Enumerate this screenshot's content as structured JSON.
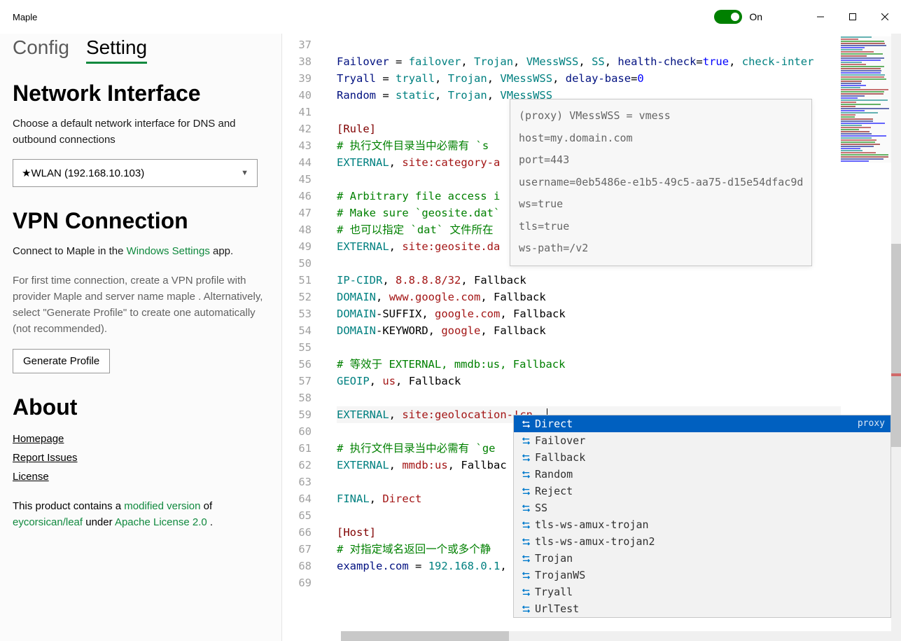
{
  "window": {
    "title": "Maple",
    "toggle_label": "On",
    "toggle_on": true
  },
  "tabs": {
    "config": "Config",
    "setting": "Setting",
    "active": "setting"
  },
  "sidebar": {
    "net_h": "Network Interface",
    "net_p": "Choose a default network interface for DNS and outbound connections",
    "net_select": "★WLAN (192.168.10.103)",
    "vpn_h": "VPN Connection",
    "vpn_p1a": "Connect to Maple in the ",
    "vpn_p1b": "Windows Settings",
    "vpn_p1c": " app.",
    "vpn_p2": "For first time connection, create a VPN profile with provider Maple and server name maple . Alternatively, select \"Generate Profile\" to create one automatically (not recommended).",
    "vpn_btn": "Generate Profile",
    "about_h": "About",
    "about_l1": "Homepage",
    "about_l2": "Report Issues",
    "about_l3": "License",
    "about_p_a": "This product contains a ",
    "about_p_b": "modified version",
    "about_p_c": " of ",
    "about_p_d": "eycorsican/leaf",
    "about_p_e": " under ",
    "about_p_f": "Apache License 2.0",
    "about_p_g": " ."
  },
  "editor": {
    "first_line_no": 37,
    "lines": [
      "",
      "Failover = failover, Trojan, VMessWSS, SS, health-check=true, check-inter",
      "Tryall = tryall, Trojan, VMessWSS, delay-base=0",
      "Random = static, Trojan, VMessWSS",
      "",
      "[Rule]",
      "# 执行文件目录当中必需有 `s",
      "EXTERNAL, site:category-a",
      "",
      "# Arbitrary file access i",
      "# Make sure `geosite.dat`",
      "# 也可以指定 `dat` 文件所在",
      "EXTERNAL, site:geosite.da",
      "",
      "IP-CIDR, 8.8.8.8/32, Fallback",
      "DOMAIN, www.google.com, Fallback",
      "DOMAIN-SUFFIX, google.com, Fallback",
      "DOMAIN-KEYWORD, google, Fallback",
      "",
      "# 等效于 EXTERNAL, mmdb:us, Fallback",
      "GEOIP, us, Fallback",
      "",
      "EXTERNAL, site:geolocation-!cn, ",
      "",
      "# 执行文件目录当中必需有 `ge",
      "EXTERNAL, mmdb:us, Fallbac",
      "",
      "FINAL, Direct",
      "",
      "[Host]",
      "# 对指定域名返回一个或多个静",
      "example.com = 192.168.0.1,",
      ""
    ],
    "cursor_line": 59
  },
  "hover": {
    "l0": "(proxy) VMessWSS = vmess",
    "l1": "host=my.domain.com",
    "l2": "port=443",
    "l3": "username=0eb5486e-e1b5-49c5-aa75-d15e54dfac9d",
    "l4": "ws=true",
    "l5": "tls=true",
    "l6": "ws-path=/v2"
  },
  "suggest": {
    "kind": "proxy",
    "items": [
      "Direct",
      "Failover",
      "Fallback",
      "Random",
      "Reject",
      "SS",
      "tls-ws-amux-trojan",
      "tls-ws-amux-trojan2",
      "Trojan",
      "TrojanWS",
      "Tryall",
      "UrlTest"
    ],
    "selected": 0
  }
}
